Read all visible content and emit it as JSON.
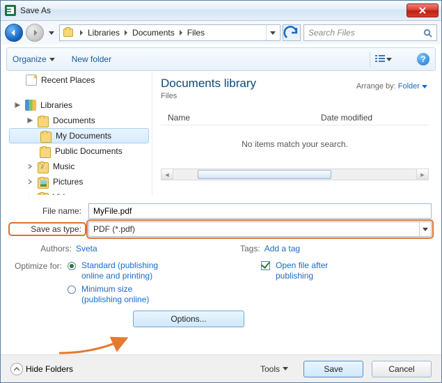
{
  "title": "Save As",
  "breadcrumb": {
    "p0": "Libraries",
    "p1": "Documents",
    "p2": "Files"
  },
  "search": {
    "placeholder": "Search Files"
  },
  "toolbar": {
    "organize": "Organize",
    "newfolder": "New folder"
  },
  "tree": {
    "recent": "Recent Places",
    "libraries": "Libraries",
    "documents": "Documents",
    "mydocs": "My Documents",
    "pubdocs": "Public Documents",
    "music": "Music",
    "pictures": "Pictures",
    "videos": "Videos"
  },
  "main": {
    "libtitle": "Documents library",
    "libsub": "Files",
    "arrangeby": "Arrange by:",
    "arrangeval": "Folder",
    "col_name": "Name",
    "col_date": "Date modified",
    "empty": "No items match your search."
  },
  "form": {
    "filename_label": "File name:",
    "filename": "MyFile.pdf",
    "savetype_label": "Save as type:",
    "savetype": "PDF (*.pdf)",
    "authors_label": "Authors:",
    "authors": "Sveta",
    "tags_label": "Tags:",
    "tags": "Add a tag",
    "optimize_label": "Optimize for:",
    "opt_standard": "Standard (publishing online and printing)",
    "opt_min": "Minimum size (publishing online)",
    "openafter": "Open file after publishing",
    "options_btn": "Options..."
  },
  "footer": {
    "hide": "Hide Folders",
    "tools": "Tools",
    "save": "Save",
    "cancel": "Cancel"
  }
}
